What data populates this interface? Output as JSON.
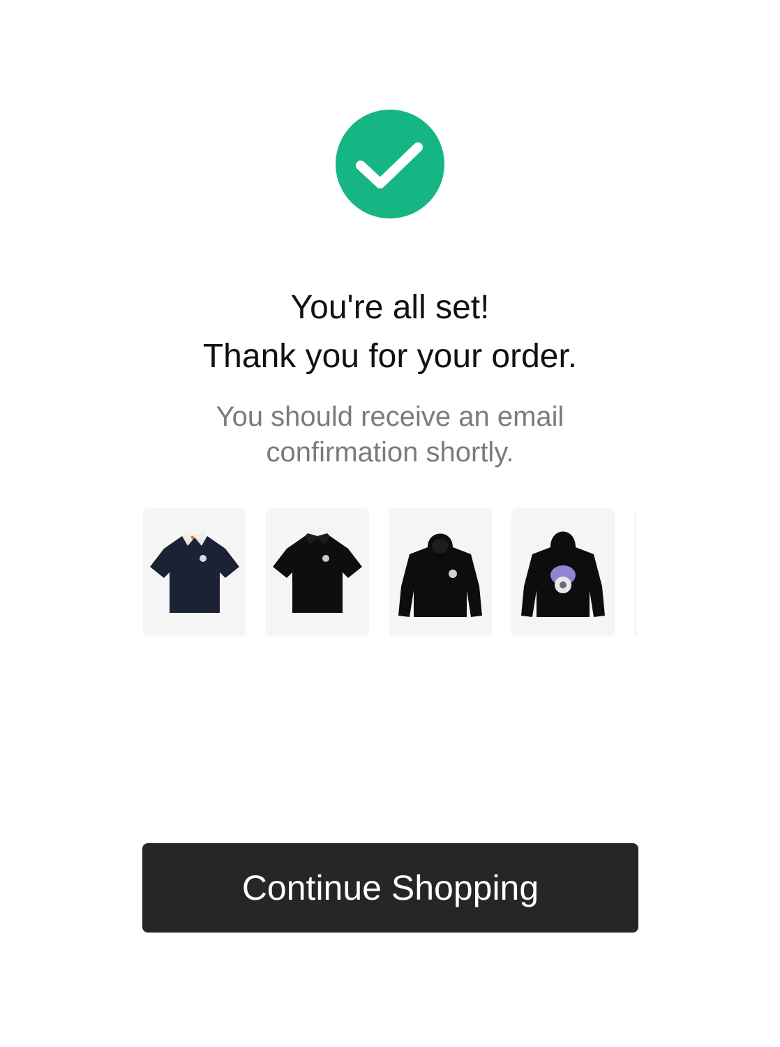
{
  "confirmation": {
    "icon": "checkmark-circle-icon",
    "accent_color": "#15b683",
    "headline_line1": "You're all set!",
    "headline_line2": "Thank you for your order.",
    "subtext_line1": "You should receive an email",
    "subtext_line2": "confirmation shortly."
  },
  "order_items": [
    {
      "icon": "navy-polo-shirt-icon"
    },
    {
      "icon": "black-polo-shirt-icon"
    },
    {
      "icon": "black-hoodie-front-icon"
    },
    {
      "icon": "black-hoodie-back-graphic-icon"
    }
  ],
  "actions": {
    "continue_label": "Continue Shopping",
    "button_color": "#262628"
  }
}
